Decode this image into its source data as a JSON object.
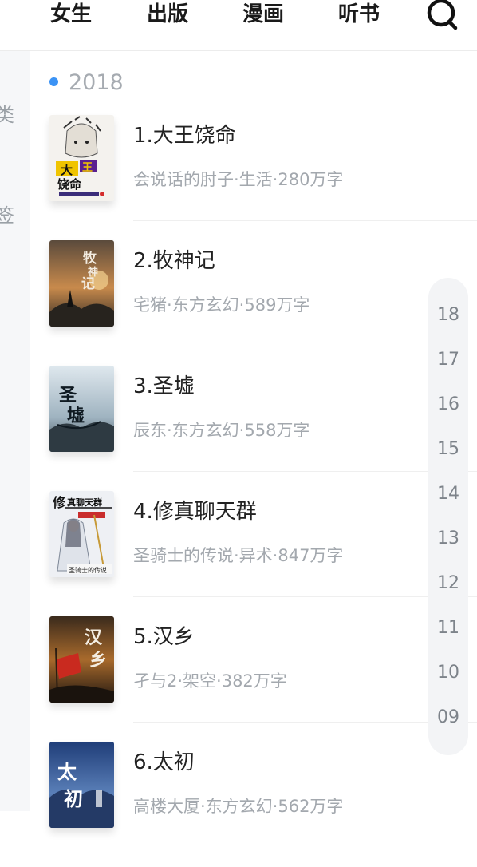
{
  "nav": {
    "tabs": [
      "女生",
      "出版",
      "漫画",
      "听书"
    ],
    "search_icon": "search-icon"
  },
  "sidebar": {
    "items": [
      "类",
      "签"
    ]
  },
  "section": {
    "year": "2018",
    "accent_color": "#3b93f5"
  },
  "books": [
    {
      "title": "1.大王饶命",
      "meta": "会说话的肘子·生活·280万字",
      "cover_text": "大王饶命"
    },
    {
      "title": "2.牧神记",
      "meta": "宅猪·东方玄幻·589万字",
      "cover_text": "牧神记"
    },
    {
      "title": "3.圣墟",
      "meta": "辰东·东方玄幻·558万字",
      "cover_text": "圣墟"
    },
    {
      "title": "4.修真聊天群",
      "meta": "圣骑士的传说·异术·847万字",
      "cover_text": "修真聊天群"
    },
    {
      "title": "5.汉乡",
      "meta": "孑与2·架空·382万字",
      "cover_text": "汉乡"
    },
    {
      "title": "6.太初",
      "meta": "高楼大厦·东方玄幻·562万字",
      "cover_text": "太初"
    }
  ],
  "year_index": [
    "18",
    "17",
    "16",
    "15",
    "14",
    "13",
    "12",
    "11",
    "10",
    "09"
  ]
}
